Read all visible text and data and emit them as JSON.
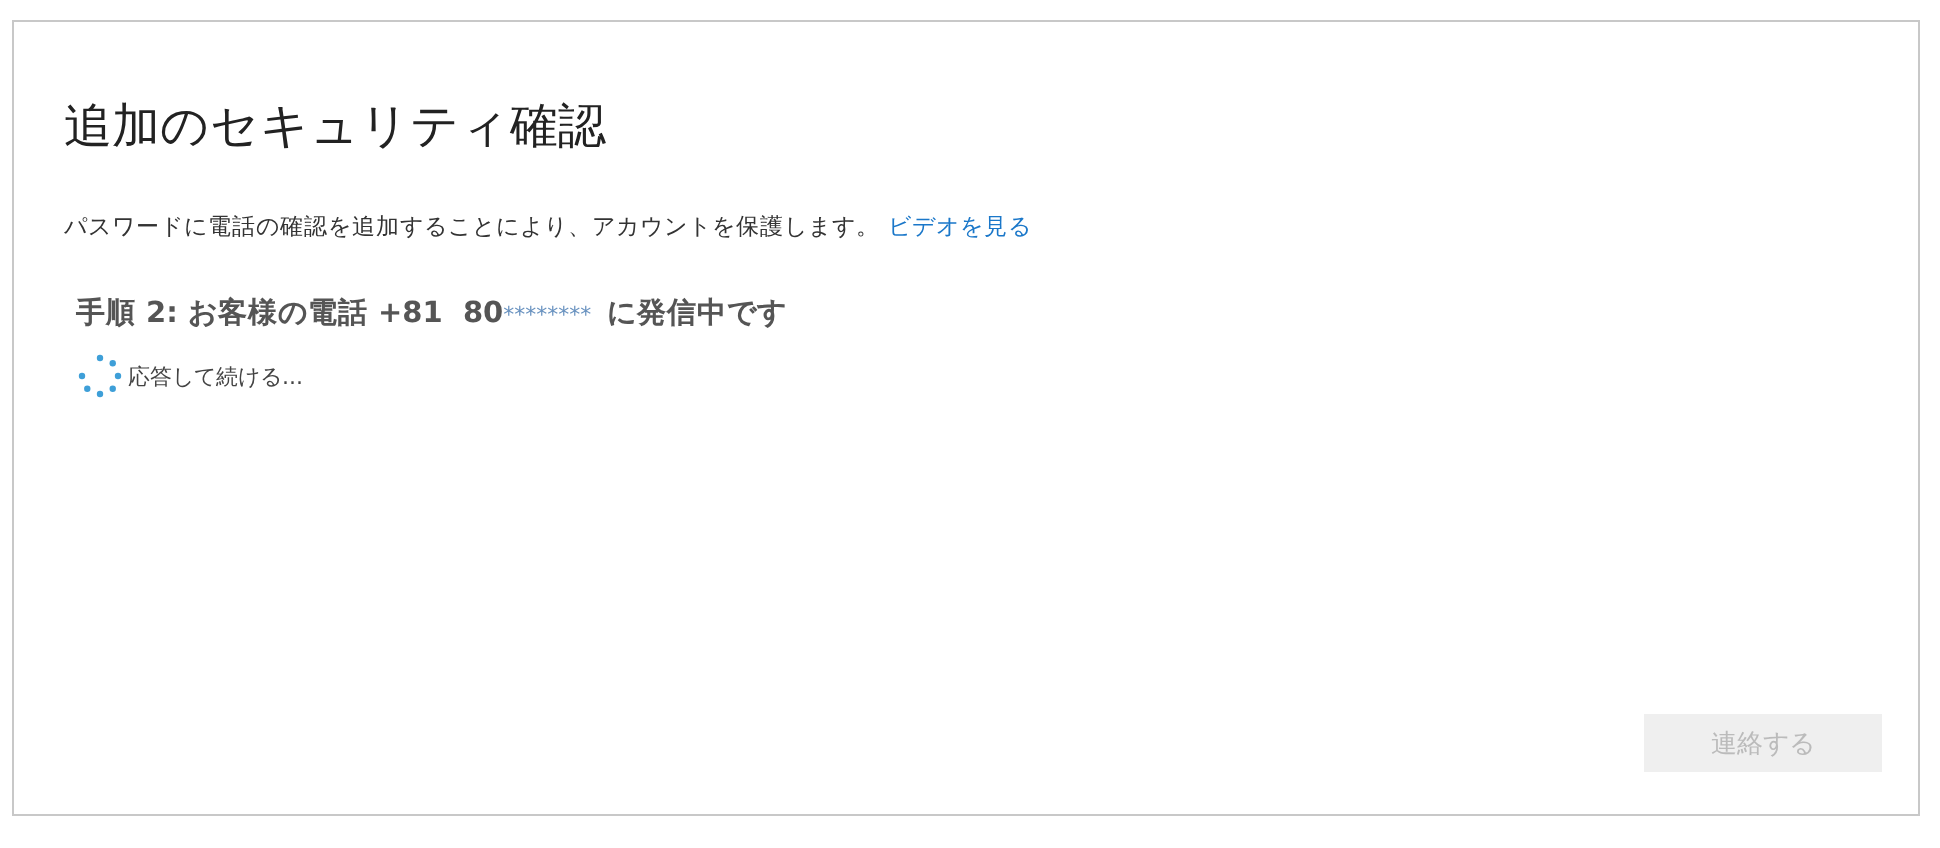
{
  "title": "追加のセキュリティ確認",
  "description": {
    "text": "パスワードに電話の確認を追加することにより、アカウントを保護します。",
    "link": "ビデオを見る"
  },
  "step": {
    "prefix": "手順 2: お客様の電話 +81  80",
    "masked": "********",
    "suffix": "に発信中です"
  },
  "status": "応答して続ける...",
  "button": {
    "label": "連絡する",
    "disabled": true
  }
}
